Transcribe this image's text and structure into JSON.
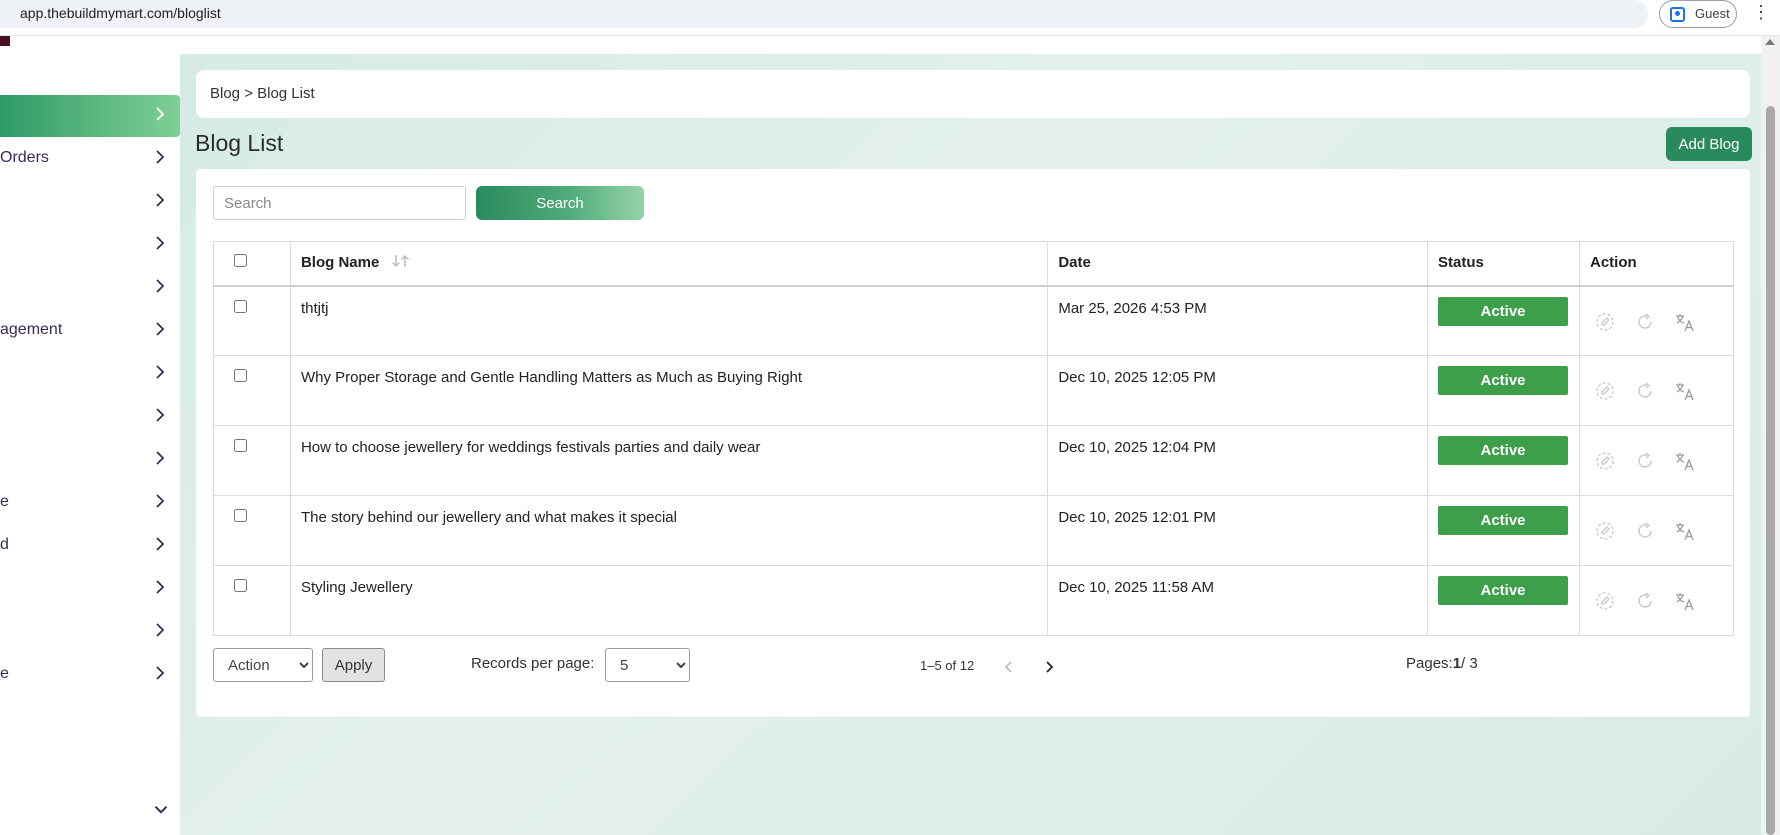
{
  "browser": {
    "url": "app.thebuildmymart.com/bloglist",
    "profile_label": "Guest"
  },
  "sidebar": {
    "items": [
      {
        "label": ""
      },
      {
        "label": "Orders"
      },
      {
        "label": ""
      },
      {
        "label": ""
      },
      {
        "label": ""
      },
      {
        "label": "agement"
      },
      {
        "label": ""
      },
      {
        "label": ""
      },
      {
        "label": ""
      },
      {
        "label": "e"
      },
      {
        "label": "d"
      },
      {
        "label": ""
      },
      {
        "label": ""
      },
      {
        "label": "e"
      }
    ]
  },
  "breadcrumb": "Blog > Blog List",
  "page_title": "Blog List",
  "add_button": "Add Blog",
  "search": {
    "placeholder": "Search",
    "button_label": "Search"
  },
  "table": {
    "headers": {
      "name": "Blog Name",
      "date": "Date",
      "status": "Status",
      "action": "Action"
    },
    "rows": [
      {
        "name": "thtjtj",
        "date": "Mar 25, 2026 4:53 PM",
        "status": "Active"
      },
      {
        "name": "Why Proper Storage and Gentle Handling Matters as Much as Buying Right",
        "date": "Dec 10, 2025 12:05 PM",
        "status": "Active"
      },
      {
        "name": "How to choose jewellery for weddings festivals parties and daily wear",
        "date": "Dec 10, 2025 12:04 PM",
        "status": "Active"
      },
      {
        "name": "The story behind our jewellery and what makes it special",
        "date": "Dec 10, 2025 12:01 PM",
        "status": "Active"
      },
      {
        "name": "Styling Jewellery",
        "date": "Dec 10, 2025 11:58 AM",
        "status": "Active"
      }
    ]
  },
  "footer": {
    "bulk_action": "Action",
    "apply_label": "Apply",
    "records_per_page_label": "Records per page:",
    "records_per_page_value": "5",
    "range_text": "1–5 of 12",
    "pages_label": "Pages:",
    "current_page": "1",
    "total_pages": "/ 3"
  },
  "colors": {
    "accent": "#2a8a5e",
    "status_active": "#3d9f4a",
    "sidebar_text": "#3b2a57"
  }
}
